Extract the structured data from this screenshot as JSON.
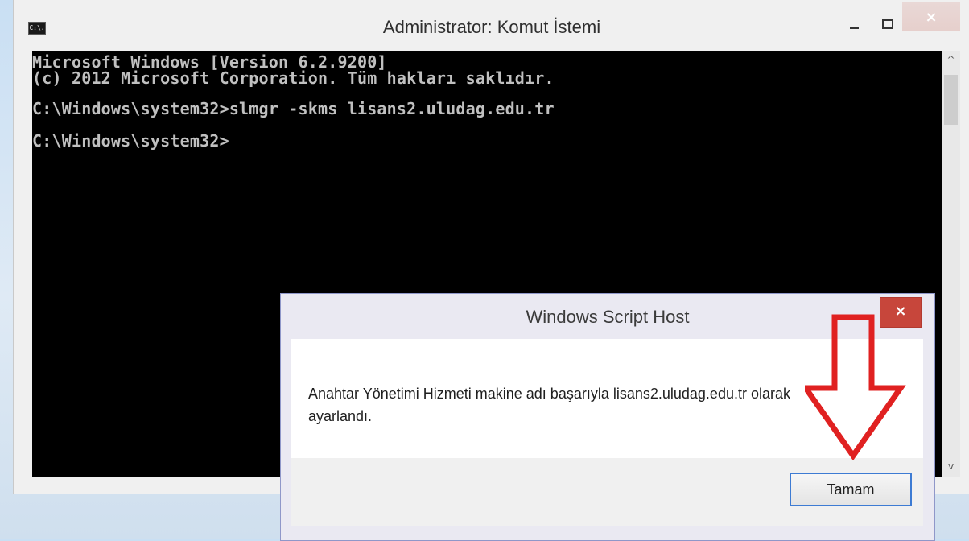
{
  "cmd_window": {
    "title": "Administrator: Komut İstemi",
    "icon_label": "C:\\.",
    "console_lines": [
      "Microsoft Windows [Version 6.2.9200]",
      "(c) 2012 Microsoft Corporation. Tüm hakları saklıdır.",
      "C:\\Windows\\system32>slmgr -skms lisans2.uludag.edu.tr",
      "C:\\Windows\\system32>"
    ],
    "scroll_up": "^",
    "scroll_down": "v",
    "close_glyph": "×"
  },
  "dialog": {
    "title": "Windows Script Host",
    "message_line1": "Anahtar Yönetimi Hizmeti makine adı başarıyla lisans2.uludag.edu.tr olarak",
    "message_line2": "ayarlandı.",
    "ok_label": "Tamam",
    "close_glyph": "×"
  },
  "colors": {
    "console_bg": "#000000",
    "console_text": "#c0c0c0",
    "dialog_close": "#c7463b",
    "annotation_arrow": "#e02121"
  },
  "icons": [
    "cmd-app-icon",
    "minimize-icon",
    "maximize-icon",
    "close-icon",
    "annotation-arrow"
  ]
}
